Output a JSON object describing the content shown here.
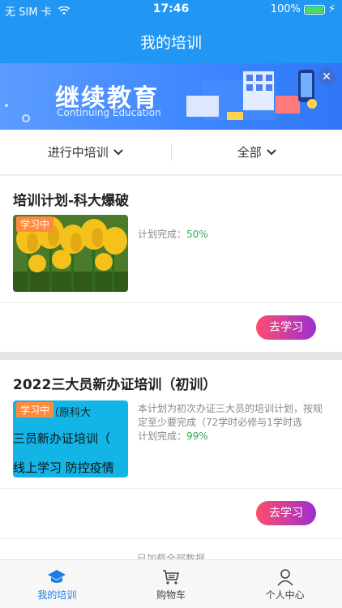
{
  "status": {
    "carrier": "无 SIM 卡",
    "time": "17:46",
    "battery": "100%"
  },
  "header": {
    "title": "我的培训"
  },
  "banner": {
    "main": "继续教育",
    "sub": "Continuing Education"
  },
  "filters": {
    "status": "进行中培训",
    "scope": "全部"
  },
  "cards": [
    {
      "title": "培训计划-科大爆破",
      "tag": "学习中",
      "progress_label": "计划完成：",
      "progress_value": "50%",
      "progress_fraction": 0.5,
      "button": "去学习"
    },
    {
      "title": "2022三大员新办证培训（初训）",
      "tag": "学习中",
      "thumb_lines": [
        "学校（原科大",
        "三员新办证培训（",
        "线上学习 防控疫情"
      ],
      "description": "本计划为初次办证三大员的培训计划，按规定至少要完成（72学时必修与1学时选",
      "progress_label": "计划完成：",
      "progress_value": "99%",
      "progress_fraction": 0.99,
      "button": "去学习"
    }
  ],
  "footer": {
    "loaded": "已加载全部数据"
  },
  "tabbar": [
    {
      "label": "我的培训",
      "icon": "graduation-cap-icon",
      "active": true
    },
    {
      "label": "购物车",
      "icon": "cart-icon",
      "active": false
    },
    {
      "label": "个人中心",
      "icon": "user-icon",
      "active": false
    }
  ],
  "colors": {
    "primary": "#2196f3",
    "accent_green": "#2eaa55",
    "tag_orange": "#ff8a3d"
  }
}
